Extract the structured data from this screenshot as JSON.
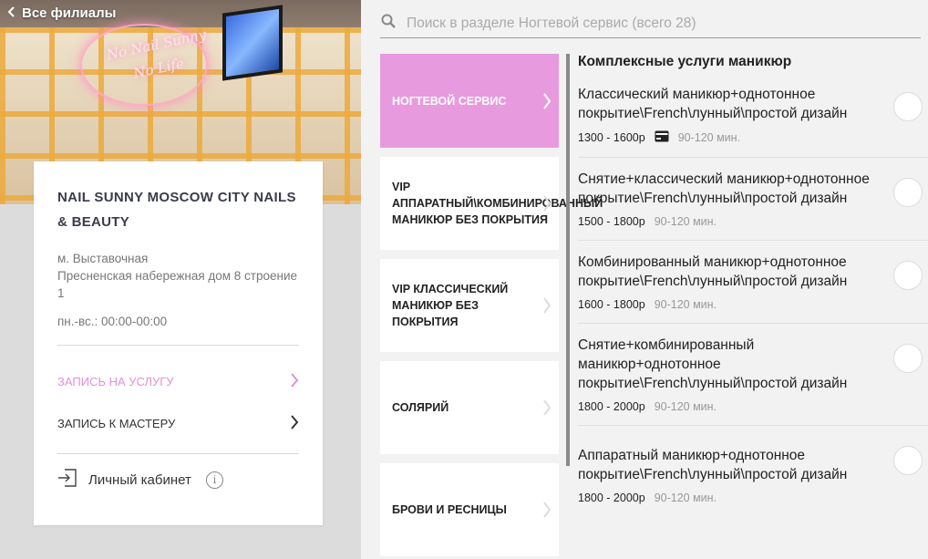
{
  "left": {
    "back_label": "Все филиалы",
    "hero": {
      "neon_line1": "No Nail Sunny",
      "neon_line2": "No Life"
    },
    "salon_name": "NAIL SUNNY MOSCOW CITY NAILS & BEAUTY",
    "metro": "м. Выставочная",
    "address": "Пресненская набережная дом 8 строение 1",
    "hours": "пн.-вс.: 00:00-00:00",
    "book_service_label": "ЗАПИСЬ НА УСЛУГУ",
    "book_master_label": "ЗАПИСЬ К МАСТЕРУ",
    "cabinet_label": "Личный кабинет",
    "accent_color": "#e090d8"
  },
  "search": {
    "placeholder": "Поиск в разделе Ногтевой сервис (всего 28)"
  },
  "categories": [
    {
      "label": "НОГТЕВОЙ СЕРВИС",
      "active": true
    },
    {
      "label": "VIP АППАРАТНЫЙ\\КОМБИНИРОВАННЫЙ МАНИКЮР БЕЗ ПОКРЫТИЯ",
      "active": false
    },
    {
      "label": "VIP КЛАССИЧЕСКИЙ МАНИКЮР БЕЗ ПОКРЫТИЯ",
      "active": false
    },
    {
      "label": "СОЛЯРИЙ",
      "active": false
    },
    {
      "label": "БРОВИ И РЕСНИЦЫ",
      "active": false
    }
  ],
  "services": {
    "group_title": "Комплексные услуги маникюр",
    "items": [
      {
        "name": "Классический маникюр+однотонное покрытие\\French\\лунный\\простой дизайн",
        "price": "1300 - 1600р",
        "card_icon": true,
        "duration": "90-120 мин."
      },
      {
        "name": "Снятие+классический маникюр+однотонное покрытие\\French\\лунный\\простой дизайн",
        "price": "1500 - 1800р",
        "card_icon": false,
        "duration": "90-120 мин."
      },
      {
        "name": "Комбинированный маникюр+однотонное покрытие\\French\\лунный\\простой дизайн",
        "price": "1600 - 1800р",
        "card_icon": false,
        "duration": "90-120 мин."
      },
      {
        "name": "Снятие+комбинированный маникюр+однотонное покрытие\\French\\лунный\\простой дизайн",
        "price": "1800 - 2000р",
        "card_icon": false,
        "duration": "90-120 мин."
      },
      {
        "name": "Аппаратный маникюр+однотонное покрытие\\French\\лунный\\простой дизайн",
        "price": "1800 - 2000р",
        "card_icon": false,
        "duration": "90-120 мин."
      }
    ]
  }
}
